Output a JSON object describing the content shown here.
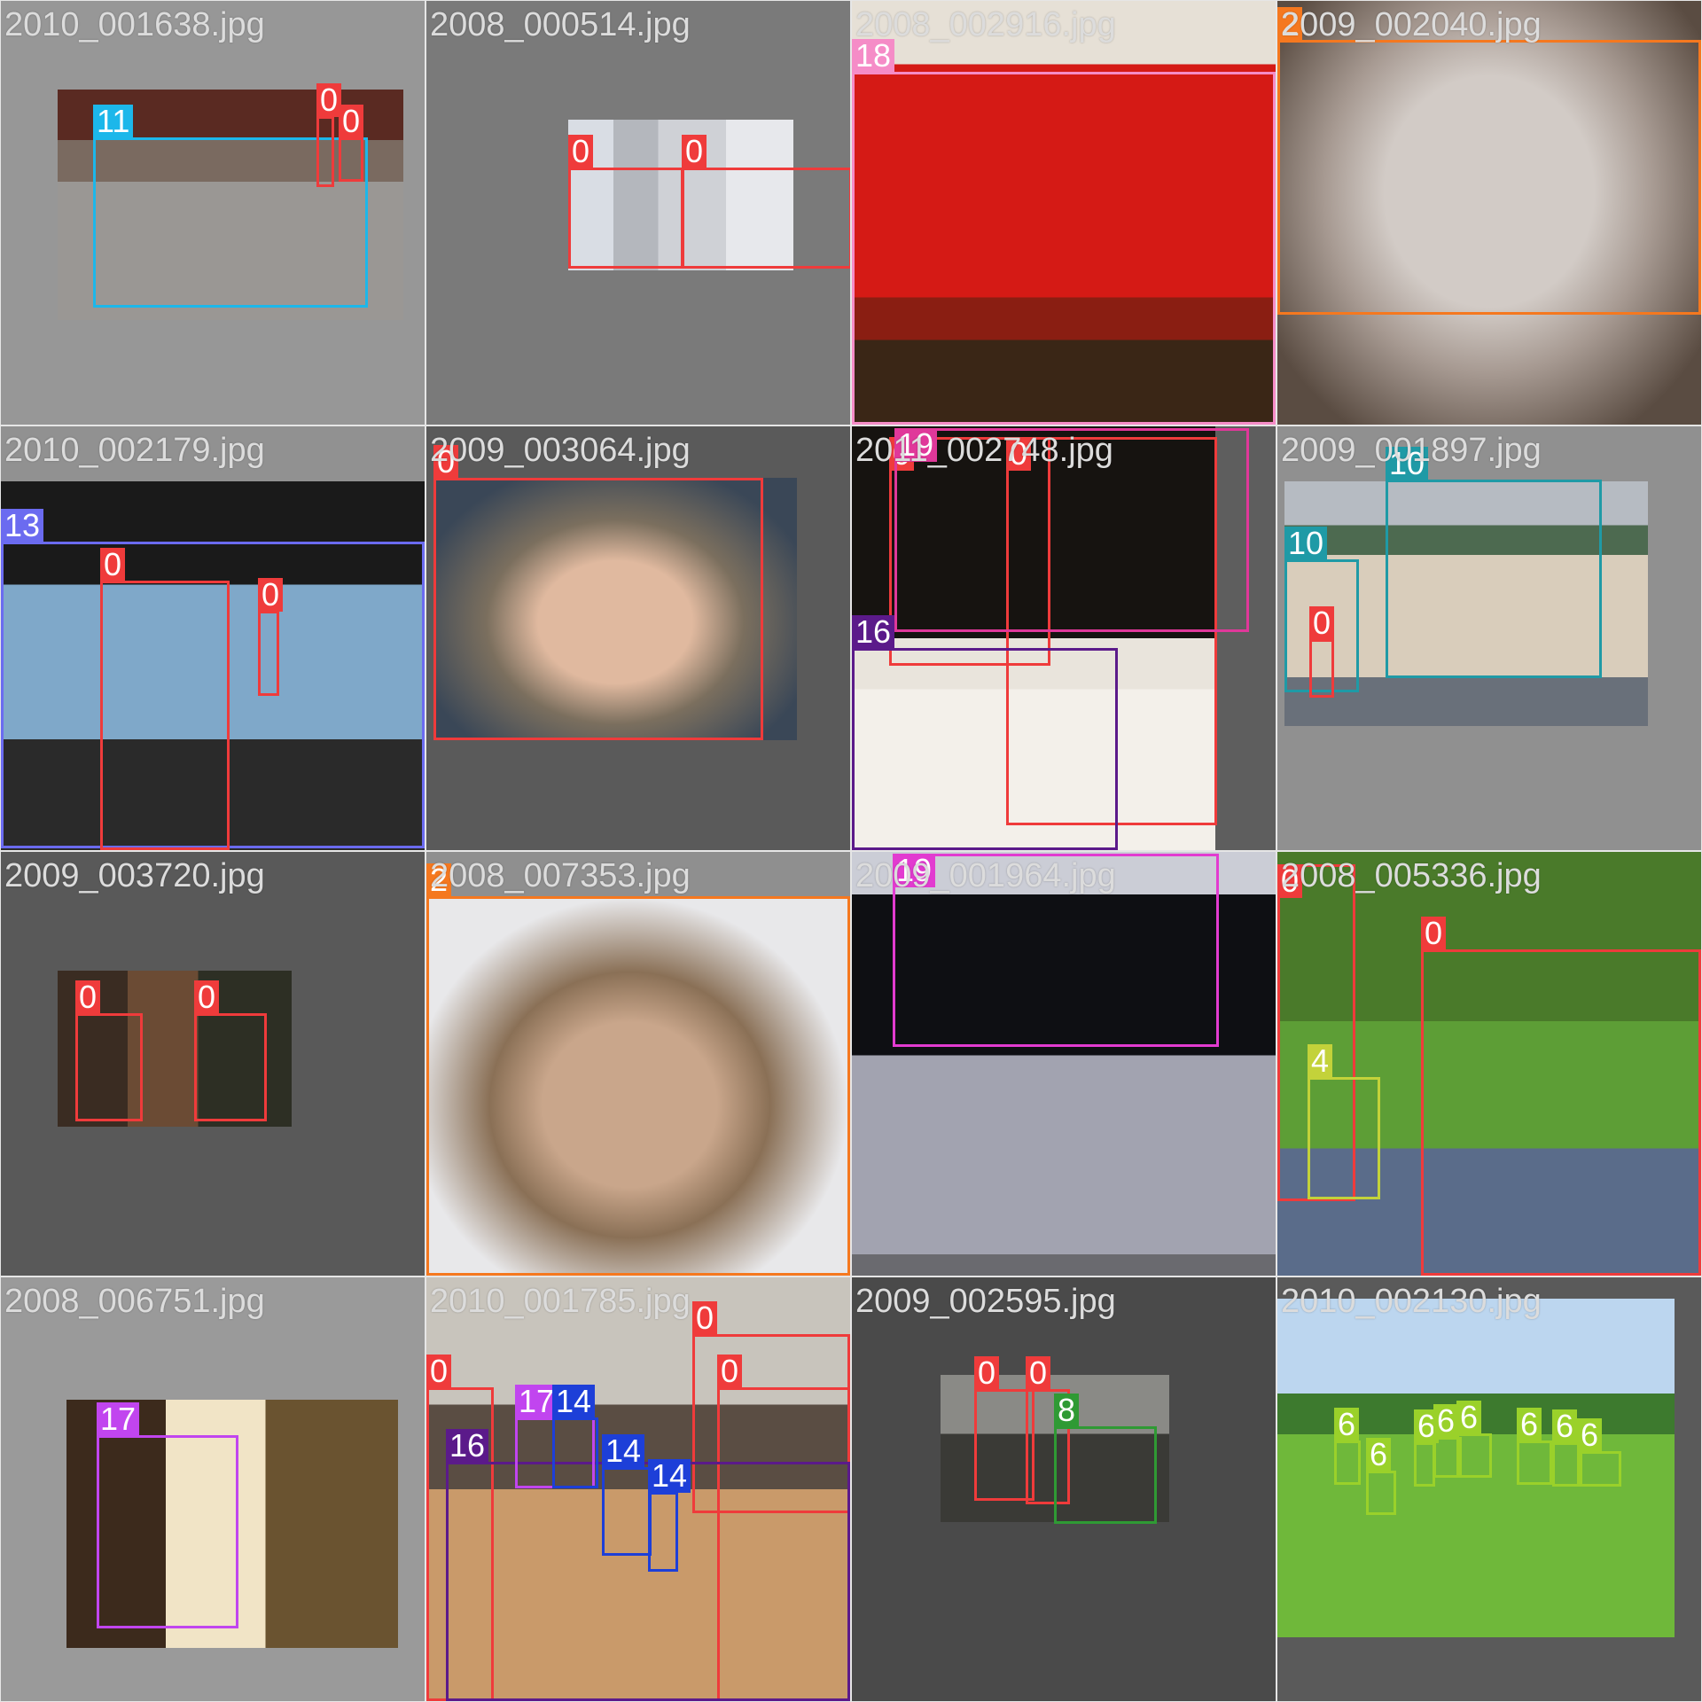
{
  "mosaic": {
    "tiles": [
      {
        "filename": "2010_001638.jpg",
        "tile_bg": "#979797",
        "scene": "car",
        "boxes": [
          {
            "label": "11",
            "color": "#1cb7ea"
          },
          {
            "label": "0",
            "color": "#ef3b3b"
          },
          {
            "label": "0",
            "color": "#ef3b3b"
          }
        ]
      },
      {
        "filename": "2008_000514.jpg",
        "tile_bg": "#7a7a7a",
        "scene": "people-indoor",
        "boxes": [
          {
            "label": "0",
            "color": "#ef3b3b"
          },
          {
            "label": "0",
            "color": "#ef3b3b"
          }
        ]
      },
      {
        "filename": "2008_002916.jpg",
        "tile_bg": "#5e5e5e",
        "scene": "red-sofa",
        "boxes": [
          {
            "label": "18",
            "color": "#f58cc7"
          }
        ]
      },
      {
        "filename": "2009_002040.jpg",
        "tile_bg": "#5c5c5c",
        "scene": "cat-closeup",
        "boxes": [
          {
            "label": "2",
            "color": "#f5781f"
          }
        ]
      },
      {
        "filename": "2010_002179.jpg",
        "tile_bg": "#919191",
        "scene": "train",
        "boxes": [
          {
            "label": "13",
            "color": "#6b6bf0"
          },
          {
            "label": "0",
            "color": "#ef3b3b"
          },
          {
            "label": "0",
            "color": "#ef3b3b"
          }
        ]
      },
      {
        "filename": "2009_003064.jpg",
        "tile_bg": "#5a5a5a",
        "scene": "woman-selfie",
        "boxes": [
          {
            "label": "0",
            "color": "#ef3b3b"
          }
        ]
      },
      {
        "filename": "2011_002748.jpg",
        "tile_bg": "#5e5e5e",
        "scene": "two-men-dinner",
        "boxes": [
          {
            "label": "0",
            "color": "#ef3b3b"
          },
          {
            "label": "0",
            "color": "#ef3b3b"
          },
          {
            "label": "16",
            "color": "#5b1a8a"
          },
          {
            "label": "19",
            "color": "#e0389a"
          }
        ]
      },
      {
        "filename": "2009_001897.jpg",
        "tile_bg": "#909090",
        "scene": "buses",
        "boxes": [
          {
            "label": "10",
            "color": "#1f9aa6"
          },
          {
            "label": "10",
            "color": "#1f9aa6"
          },
          {
            "label": "0",
            "color": "#ef3b3b"
          }
        ]
      },
      {
        "filename": "2009_003720.jpg",
        "tile_bg": "#595959",
        "scene": "two-people-room",
        "boxes": [
          {
            "label": "0",
            "color": "#ef3b3b"
          },
          {
            "label": "0",
            "color": "#ef3b3b"
          }
        ]
      },
      {
        "filename": "2008_007353.jpg",
        "tile_bg": "#8f8f8f",
        "scene": "kitten",
        "boxes": [
          {
            "label": "2",
            "color": "#f5781f"
          }
        ]
      },
      {
        "filename": "2009_001964.jpg",
        "tile_bg": "#5f5f5f",
        "scene": "laptop",
        "boxes": [
          {
            "label": "19",
            "color": "#e23bd0"
          }
        ]
      },
      {
        "filename": "2008_005336.jpg",
        "tile_bg": "#5d5d5d",
        "scene": "garden-people-dog",
        "boxes": [
          {
            "label": "0",
            "color": "#ef3b3b"
          },
          {
            "label": "0",
            "color": "#ef3b3b"
          },
          {
            "label": "4",
            "color": "#c3d23a"
          }
        ]
      },
      {
        "filename": "2008_006751.jpg",
        "tile_bg": "#9a9a9a",
        "scene": "flower-pot",
        "boxes": [
          {
            "label": "17",
            "color": "#c145ef"
          }
        ]
      },
      {
        "filename": "2010_001785.jpg",
        "tile_bg": "#6d6d6d",
        "scene": "dinner-table",
        "boxes": [
          {
            "label": "0",
            "color": "#ef3b3b"
          },
          {
            "label": "0",
            "color": "#ef3b3b"
          },
          {
            "label": "0",
            "color": "#ef3b3b"
          },
          {
            "label": "16",
            "color": "#5b1a8a"
          },
          {
            "label": "17",
            "color": "#c145ef"
          },
          {
            "label": "14",
            "color": "#1d3fd8"
          },
          {
            "label": "14",
            "color": "#1d3fd8"
          },
          {
            "label": "14",
            "color": "#1d3fd8"
          }
        ]
      },
      {
        "filename": "2009_002595.jpg",
        "tile_bg": "#4a4a4a",
        "scene": "motorbikes",
        "boxes": [
          {
            "label": "0",
            "color": "#ef3b3b"
          },
          {
            "label": "0",
            "color": "#ef3b3b"
          },
          {
            "label": "8",
            "color": "#2f9a34"
          }
        ]
      },
      {
        "filename": "2010_002130.jpg",
        "tile_bg": "#5a5a5a",
        "scene": "sheep-field",
        "boxes": [
          {
            "label": "6",
            "color": "#9ad12a"
          },
          {
            "label": "6",
            "color": "#9ad12a"
          },
          {
            "label": "6",
            "color": "#9ad12a"
          },
          {
            "label": "6",
            "color": "#9ad12a"
          },
          {
            "label": "6",
            "color": "#9ad12a"
          },
          {
            "label": "6",
            "color": "#9ad12a"
          },
          {
            "label": "6",
            "color": "#9ad12a"
          },
          {
            "label": "6",
            "color": "#9ad12a"
          }
        ]
      }
    ]
  }
}
